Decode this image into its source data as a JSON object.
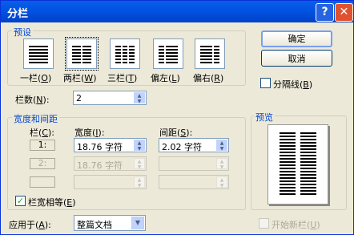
{
  "window": {
    "title": "分栏",
    "help_glyph": "?",
    "close_glyph": "✕"
  },
  "presets": {
    "group_title": "预设",
    "items": [
      {
        "label": "一栏(",
        "key": "O",
        "tail": ")"
      },
      {
        "label": "两栏(",
        "key": "W",
        "tail": ")"
      },
      {
        "label": "三栏(",
        "key": "T",
        "tail": ")"
      },
      {
        "label": "偏左(",
        "key": "L",
        "tail": ")"
      },
      {
        "label": "偏右(",
        "key": "R",
        "tail": ")"
      }
    ]
  },
  "buttons": {
    "ok": "确定",
    "cancel": "取消"
  },
  "divider": {
    "label": "分隔线(",
    "key": "B",
    "tail": ")",
    "checked": false
  },
  "columns_count": {
    "label": "栏数(",
    "key": "N",
    "tail": "):",
    "value": "2"
  },
  "width_spacing": {
    "group_title": "宽度和间距",
    "col_header": {
      "label": "栏(",
      "key": "C",
      "tail": "):"
    },
    "width_header": {
      "label": "宽度(",
      "key": "I",
      "tail": "):"
    },
    "spacing_header": {
      "label": "间距(",
      "key": "S",
      "tail": "):"
    },
    "rows": [
      {
        "col": "1:",
        "width": "18.76 字符",
        "spacing": "2.02 字符"
      },
      {
        "col": "2:",
        "width": "18.76 字符",
        "spacing": ""
      },
      {
        "col": "",
        "width": "",
        "spacing": ""
      }
    ]
  },
  "equal_width": {
    "label": "栏宽相等(",
    "key": "E",
    "tail": ")",
    "checked": true
  },
  "apply_to": {
    "label": "应用于(",
    "key": "A",
    "tail": "):",
    "value": "整篇文档"
  },
  "preview": {
    "group_title": "预览"
  },
  "new_column": {
    "label": "开始新栏(",
    "key": "U",
    "tail": ")",
    "checked": false
  }
}
